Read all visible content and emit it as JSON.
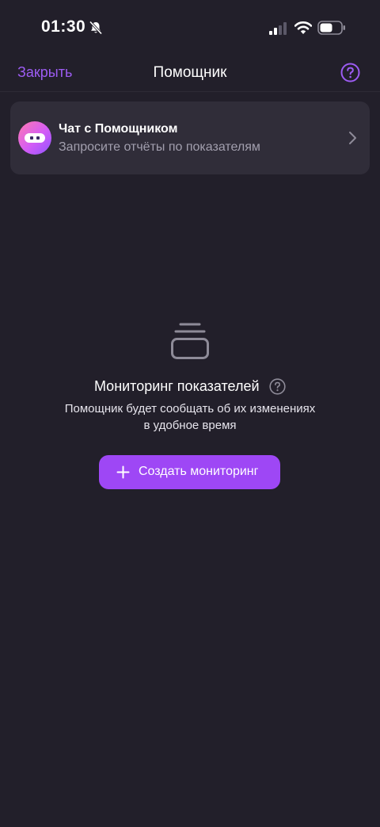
{
  "status_bar": {
    "time": "01:30",
    "icons": [
      "bell-slash-icon",
      "cellular-signal-icon",
      "wifi-icon",
      "battery-icon"
    ]
  },
  "nav": {
    "close_label": "Закрыть",
    "title": "Помощник",
    "help_icon": "question-circle-icon"
  },
  "chat_card": {
    "title": "Чат с Помощником",
    "subtitle": "Запросите отчёты по показателям",
    "avatar_icon": "assistant-avatar-icon",
    "chevron_icon": "chevron-right-icon"
  },
  "empty_state": {
    "icon": "stacked-tray-icon",
    "title": "Мониторинг показателей",
    "description_line1": "Помощник будет сообщать об их изменениях",
    "description_line2": "в удобное время",
    "help_icon": "question-circle-icon"
  },
  "create_button": {
    "label": "Создать мониторинг",
    "icon": "plus-icon"
  },
  "colors": {
    "background": "#221f2a",
    "card": "#302d39",
    "accent": "#9e47f5",
    "link": "#9d5cf3",
    "secondary_text": "#a29fae"
  }
}
